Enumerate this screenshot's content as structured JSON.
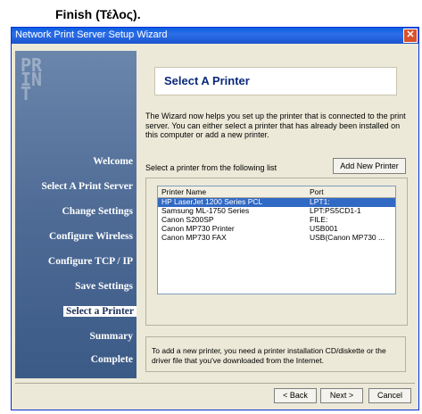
{
  "caption": "Finish (Τέλος).",
  "window": {
    "title": "Network Print Server Setup Wizard",
    "close_glyph": "✕"
  },
  "sidebar": {
    "logo_letters": "PRINT",
    "steps": [
      {
        "label": "Welcome"
      },
      {
        "label": "Select A Print Server"
      },
      {
        "label": "Change Settings"
      },
      {
        "label": "Configure Wireless"
      },
      {
        "label": "Configure TCP / IP"
      },
      {
        "label": "Save Settings"
      },
      {
        "label": "Select a Printer"
      },
      {
        "label": "Summary"
      },
      {
        "label": "Complete"
      }
    ]
  },
  "main": {
    "heading": "Select A Printer",
    "intro": "The Wizard now helps you set up the printer that is connected to the print server. You can either select a printer that has already been installed on this computer or add a new printer.",
    "list_label": "Select a printer from the following list",
    "add_printer_button": "Add New Printer",
    "columns": [
      "Printer Name",
      "Port"
    ],
    "printers": [
      {
        "name": "HP LaserJet 1200 Series PCL",
        "port": "LPT1:"
      },
      {
        "name": "Samsung ML-1750 Series",
        "port": "LPT:PS5CD1-1"
      },
      {
        "name": "Canon S200SP",
        "port": "FILE:"
      },
      {
        "name": "Canon MP730 Printer",
        "port": "USB001"
      },
      {
        "name": "Canon MP730 FAX",
        "port": "USB(Canon MP730 ..."
      }
    ],
    "note": "To add a new printer, you need a printer installation CD/diskette or the driver file that you've downloaded from the Internet."
  },
  "buttons": {
    "back": "< Back",
    "next": "Next >",
    "cancel": "Cancel"
  }
}
